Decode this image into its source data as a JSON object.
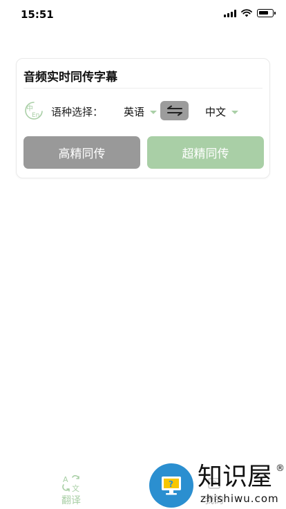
{
  "status_bar": {
    "time": "15:51"
  },
  "card": {
    "title": "音频实时同传字幕",
    "lang_icon_text": "中En",
    "lang_label": "语种选择：",
    "source_language": "英语",
    "target_language": "中文",
    "mode_hd_label": "高精同传",
    "mode_ultra_label": "超精同传"
  },
  "tab_bar": {
    "translate_label": "翻译",
    "mine_label": "我的"
  },
  "watermark": {
    "brand": "知识屋",
    "url": "zhishiwu.com",
    "reg": "®"
  },
  "colors": {
    "accent_green": "#a9cfa6",
    "button_gray": "#999999",
    "swap_gray": "#9c9c9c",
    "watermark_blue": "#2b8fd0"
  }
}
